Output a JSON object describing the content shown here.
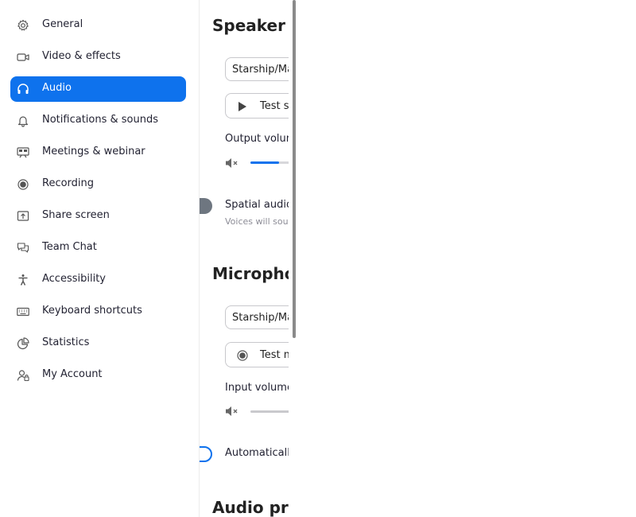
{
  "sidebar": {
    "items": [
      {
        "label": "General",
        "icon": "gear-icon"
      },
      {
        "label": "Video & effects",
        "icon": "video-icon"
      },
      {
        "label": "Audio",
        "icon": "headphones-icon",
        "active": true
      },
      {
        "label": "Notifications & sounds",
        "icon": "bell-icon"
      },
      {
        "label": "Meetings & webinar",
        "icon": "meeting-icon"
      },
      {
        "label": "Recording",
        "icon": "record-icon"
      },
      {
        "label": "Share screen",
        "icon": "share-screen-icon"
      },
      {
        "label": "Team Chat",
        "icon": "chat-icon"
      },
      {
        "label": "Accessibility",
        "icon": "accessibility-icon"
      },
      {
        "label": "Keyboard shortcuts",
        "icon": "keyboard-icon"
      },
      {
        "label": "Statistics",
        "icon": "pie-chart-icon"
      },
      {
        "label": "My Account",
        "icon": "account-icon"
      }
    ]
  },
  "speaker": {
    "title": "Speaker",
    "device": "Starship/Matisse HD Audio Controller Analog Stereo",
    "test_button": "Test speaker",
    "output_volume_label": "Output volume:",
    "output_volume_level": 0.6,
    "spatial_audio_label": "Spatial audio",
    "spatial_audio_desc": "Voices will sound like they are coming from the direction of the participant's video"
  },
  "microphone": {
    "title": "Microphone",
    "device": "Starship/Matisse HD Audio Controller Analog Stereo",
    "test_button": "Test mic",
    "input_volume_label": "Input volume:",
    "input_volume_level": 0,
    "auto_adjust_label": "Automatically adjust microphone volume"
  },
  "audio_profile": {
    "title": "Audio profile"
  },
  "colors": {
    "accent": "#0e72ed",
    "sidebar_text": "#232333",
    "muted_text": "#8c8c96"
  }
}
